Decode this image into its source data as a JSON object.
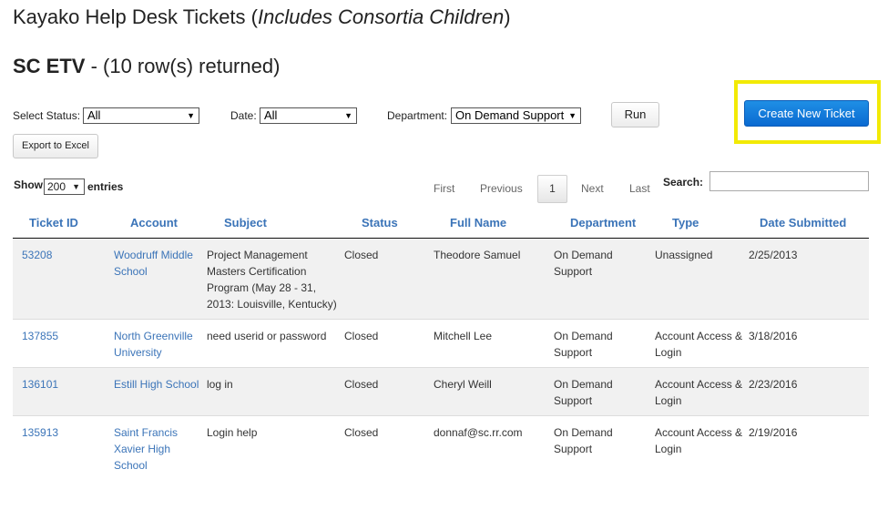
{
  "header": {
    "title": "Kayako Help Desk Tickets (",
    "title_italic": "Includes Consortia Children",
    "title_end": ")",
    "org": "SC ETV",
    "rows_text": " - (10 row(s) returned)"
  },
  "filters": {
    "status_label": "Select Status:",
    "status_value": "All",
    "date_label": "Date:",
    "date_value": "All",
    "department_label": "Department:",
    "department_value": "On Demand Support",
    "run_label": "Run",
    "export_label": "Export to Excel",
    "create_label": "Create New Ticket"
  },
  "table_controls": {
    "show_label": "Show",
    "show_value": "200",
    "entries_label": "entries",
    "first": "First",
    "previous": "Previous",
    "current_page": "1",
    "next": "Next",
    "last": "Last",
    "search_label": "Search:",
    "search_value": ""
  },
  "table": {
    "columns": [
      "Ticket ID",
      "Account",
      "Subject",
      "Status",
      "Full Name",
      "Department",
      "Type",
      "Date Submitted"
    ],
    "rows": [
      [
        "53208",
        "Woodruff Middle School",
        "Project Management Masters Certification Program (May 28 - 31, 2013: Louisville, Kentucky)",
        "Closed",
        "Theodore Samuel",
        "On Demand Support",
        "Unassigned",
        "2/25/2013"
      ],
      [
        "137855",
        "North Greenville University",
        "need userid or password",
        "Closed",
        "Mitchell Lee",
        "On Demand Support",
        "Account Access & Login",
        "3/18/2016"
      ],
      [
        "136101",
        "Estill High School",
        "log in",
        "Closed",
        "Cheryl Weill",
        "On Demand Support",
        "Account Access & Login",
        "2/23/2016"
      ],
      [
        "135913",
        "Saint Francis Xavier High School",
        "Login help",
        "Closed",
        "donnaf@sc.rr.com",
        "On Demand Support",
        "Account Access & Login",
        "2/19/2016"
      ]
    ]
  },
  "colors": {
    "link": "#3b74b8",
    "create_button": "#0a6ad1",
    "highlight": "#f2ea05"
  }
}
